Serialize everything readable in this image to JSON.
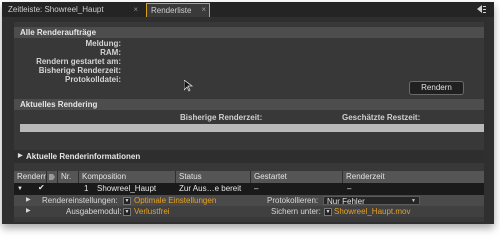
{
  "tabs": [
    {
      "label": "Zeitleiste: Showreel_Haupt",
      "close": "×"
    },
    {
      "label": "Renderliste",
      "close": "×"
    }
  ],
  "all_renders": {
    "title": "Alle Renderaufträge",
    "labels": [
      "Meldung:",
      "RAM:",
      "Rendern gestartet am:",
      "Bisherige Renderzeit:",
      "Protokolldatei:"
    ],
    "render_button": "Rendern"
  },
  "current_render": {
    "title": "Aktuelles Rendering",
    "elapsed_label": "Bisherige Renderzeit:",
    "remaining_label": "Geschätzte Restzeit:",
    "progress": 0
  },
  "current_info": {
    "title": "Aktuelle Renderinformationen"
  },
  "queue": {
    "columns": [
      "Rendern",
      "Nr.",
      "Komposition",
      "Status",
      "Gestartet",
      "Renderzeit"
    ],
    "row": {
      "number": "1",
      "composition": "Showreel_Haupt",
      "status": "Zur Aus…e bereit",
      "started": "–",
      "render_time": "–"
    },
    "settings": {
      "render_settings_label": "Rendereinstellungen:",
      "render_settings_value": "Optimale Einstellungen",
      "log_label": "Protokollieren:",
      "log_value": "Nur Fehler",
      "output_module_label": "Ausgabemodul:",
      "output_module_value": "Verlustfrei",
      "save_to_label": "Sichern unter:",
      "save_to_value": "Showreel_Haupt.mov"
    }
  },
  "colors": {
    "accent": "#d8a21a",
    "link": "#e7a022",
    "panel": "#383838",
    "header": "#4d4d4d"
  }
}
